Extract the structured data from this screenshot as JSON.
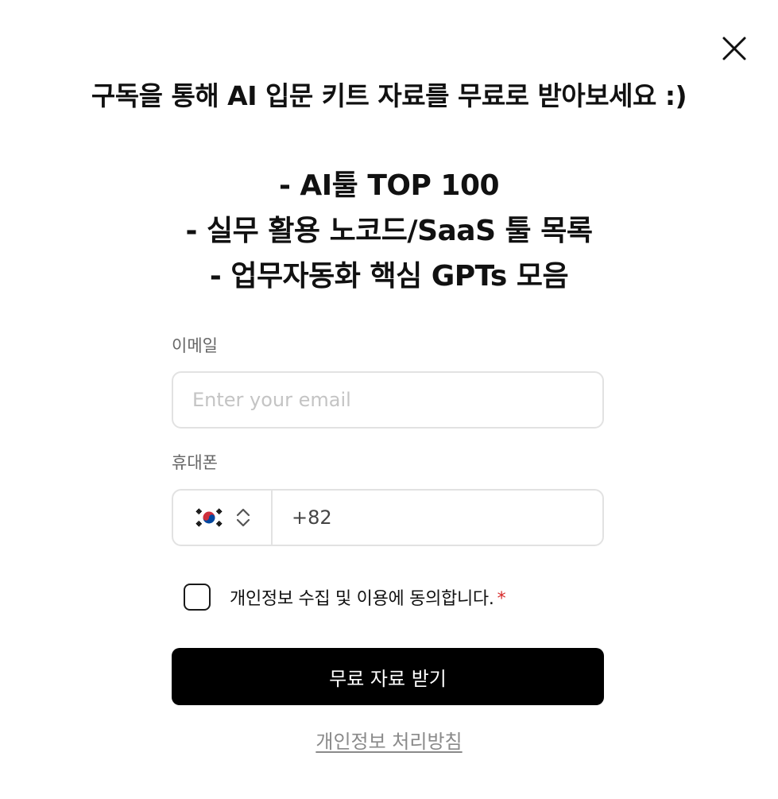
{
  "modal": {
    "close_icon": "close-icon",
    "headline": "구독을 통해 AI 입문 키트 자료를 무료로 받아보세요 :)",
    "benefits": [
      "- AI툴 TOP 100",
      "- 실무 활용 노코드/SaaS 툴 목록",
      "- 업무자동화 핵심 GPTs 모음"
    ]
  },
  "form": {
    "email": {
      "label": "이메일",
      "placeholder": "Enter your email",
      "value": ""
    },
    "phone": {
      "label": "휴대폰",
      "country_flag_icon": "south-korea-flag-icon",
      "selector_icon": "chevron-up-down-icon",
      "value": "+82"
    },
    "consent": {
      "label": "개인정보 수집 및 이용에 동의합니다.",
      "required_mark": "*",
      "checked": false
    },
    "submit_label": "무료 자료 받기",
    "privacy_link": "개인정보 처리방침"
  },
  "colors": {
    "background": "#ffffff",
    "text": "#111111",
    "button": "#000000",
    "button_text": "#ffffff",
    "required": "#d62828",
    "border": "#e2e2e2",
    "muted": "#8a8a8a"
  }
}
